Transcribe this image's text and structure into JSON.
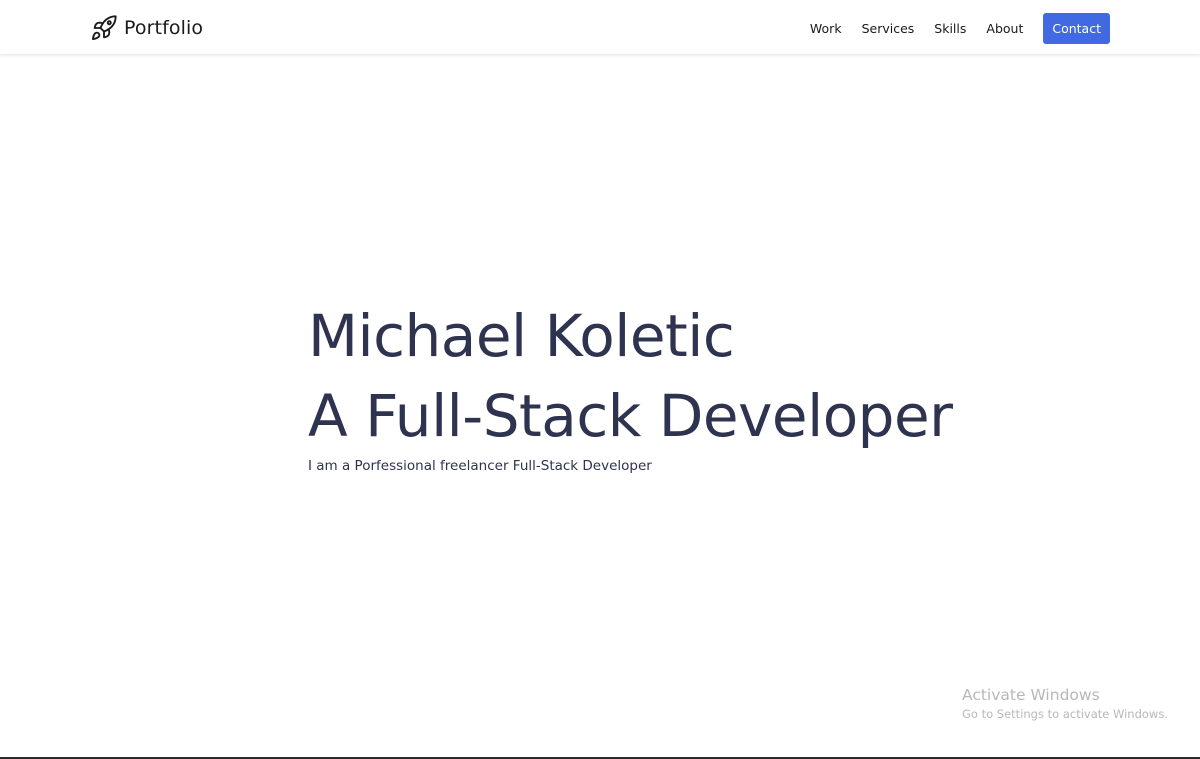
{
  "navbar": {
    "brand_text": "Portfolio",
    "brand_icon": "rocket-icon",
    "links": [
      {
        "label": "Work"
      },
      {
        "label": "Services"
      },
      {
        "label": "Skills"
      },
      {
        "label": "About"
      }
    ],
    "contact_label": "Contact"
  },
  "hero": {
    "name": "Michael Koletic",
    "role": "A Full-Stack Developer",
    "subtitle": "I am a Porfessional freelancer Full-Stack Developer"
  },
  "watermark": {
    "title": "Activate Windows",
    "subtitle": "Go to Settings to activate Windows."
  },
  "colors": {
    "accent": "#4169e1",
    "heading_text": "#2e3350",
    "background": "#ffffff"
  }
}
